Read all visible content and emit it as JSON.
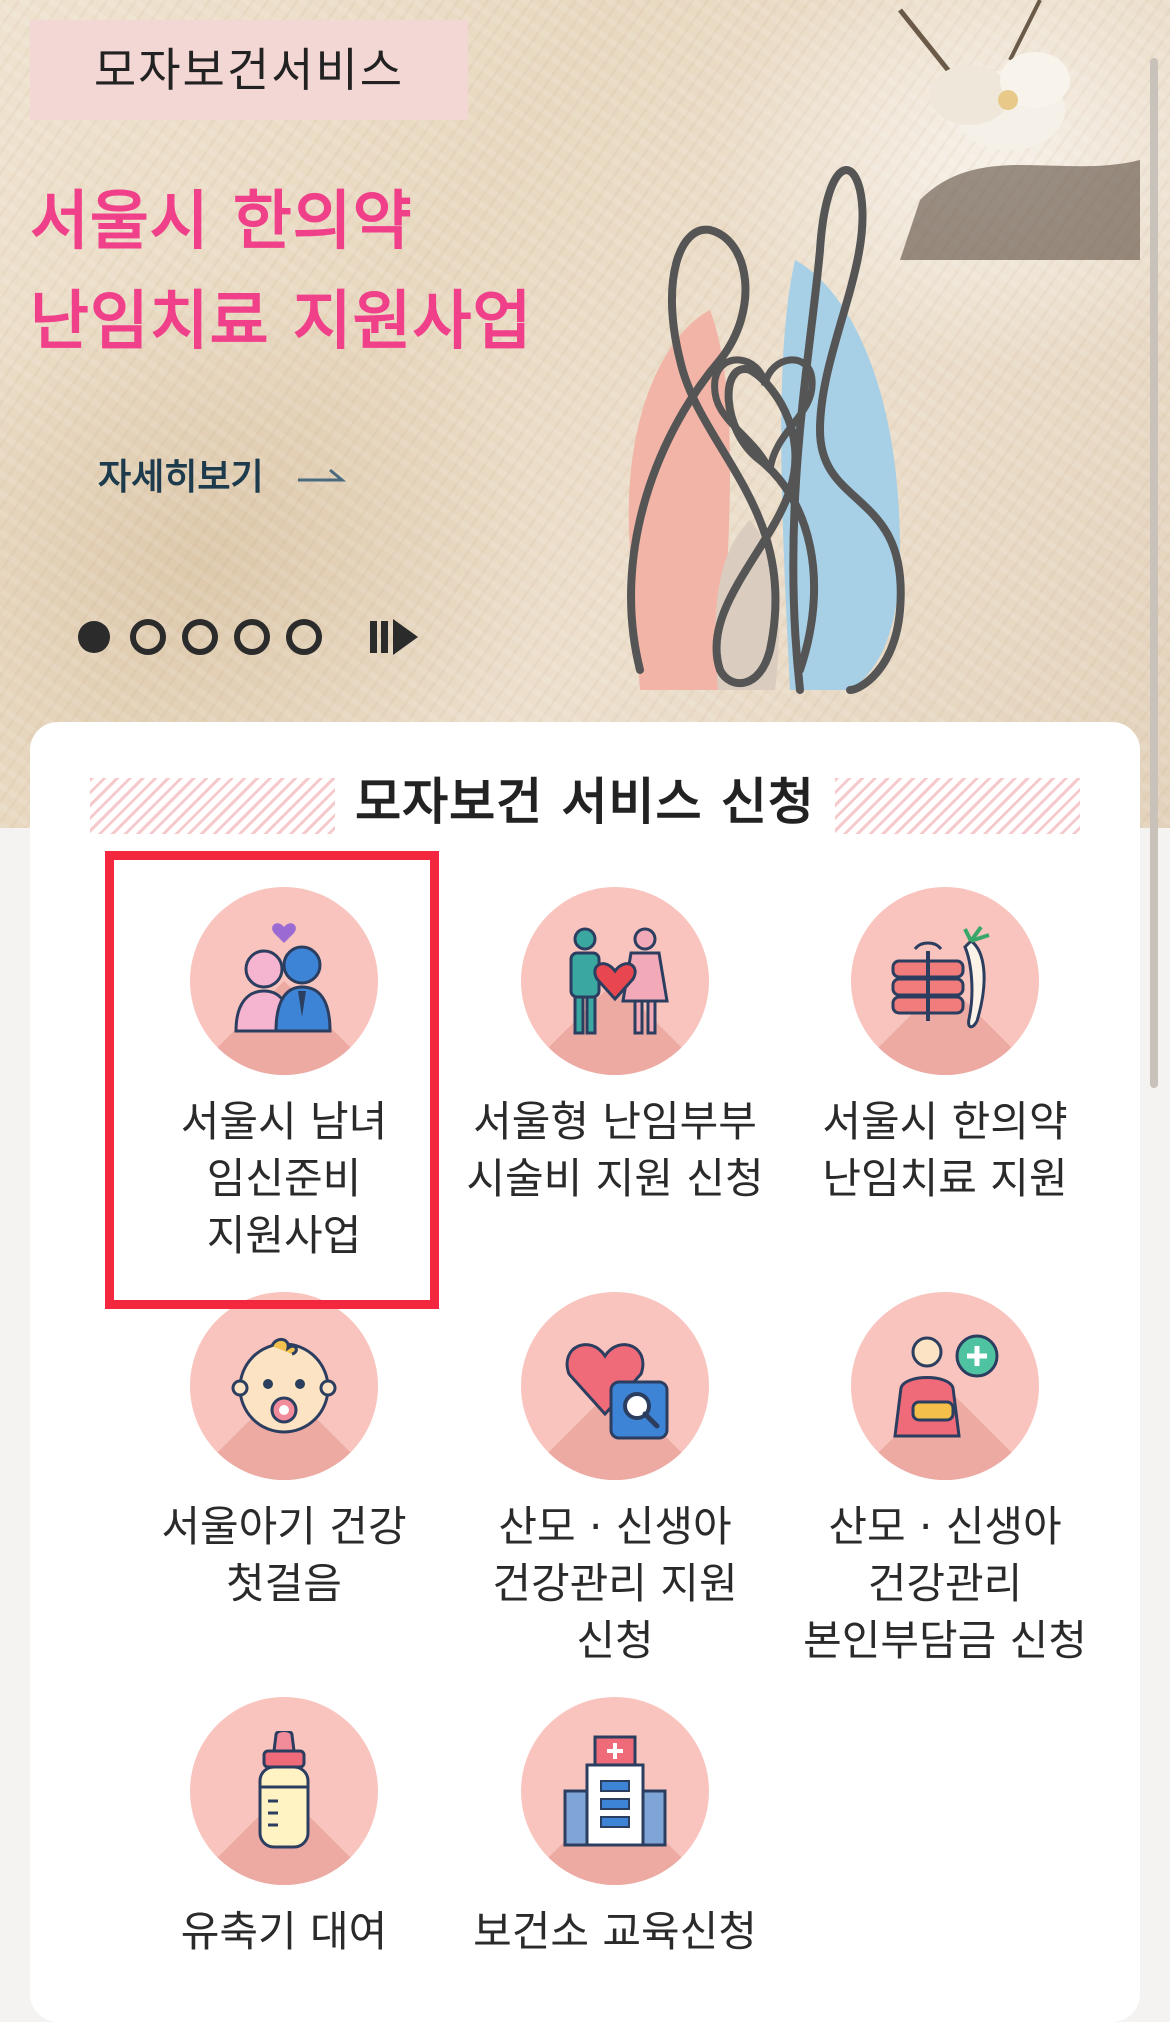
{
  "hero": {
    "label": "모자보건서비스",
    "title_line1": "서울시 한의약",
    "title_line2": "난임치료 지원사업",
    "more_link": "자세히보기",
    "slides_total": 5,
    "active_slide": 1
  },
  "section": {
    "title": "모자보건 서비스 신청"
  },
  "services": [
    {
      "label": "서울시 남녀\n임신준비\n지원사업",
      "icon": "couple-heart-icon"
    },
    {
      "label": "서울형 난임부부\n시술비 지원 신청",
      "icon": "couple-heart-sign-icon"
    },
    {
      "label": "서울시 한의약\n난임치료 지원",
      "icon": "herbal-medicine-icon"
    },
    {
      "label": "서울아기 건강\n첫걸음",
      "icon": "baby-face-icon"
    },
    {
      "label": "산모 · 신생아\n건강관리 지원\n신청",
      "icon": "heart-search-icon"
    },
    {
      "label": "산모 · 신생아\n건강관리\n본인부담금 신청",
      "icon": "caregiver-plus-icon"
    },
    {
      "label": "유축기 대여",
      "icon": "baby-bottle-icon"
    },
    {
      "label": "보건소 교육신청",
      "icon": "health-center-icon"
    }
  ],
  "colors": {
    "accent_pink": "#f0408a",
    "circle_bg": "#f9c4bd",
    "highlight_red": "#f3283f"
  }
}
